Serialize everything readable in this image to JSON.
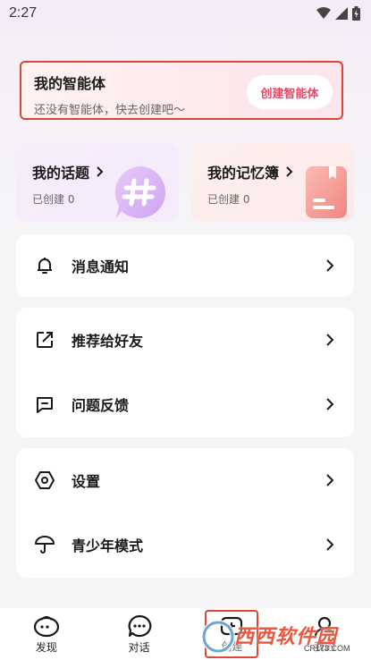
{
  "status_bar": {
    "time": "2:27"
  },
  "agent_card": {
    "title": "我的智能体",
    "subtitle": "还没有智能体，快去创建吧～",
    "create_button": "创建智能体"
  },
  "topics": {
    "title": "我的话题",
    "count": "已创建 0"
  },
  "memos": {
    "title": "我的记忆簿",
    "count": "已创建 0"
  },
  "menu": {
    "notifications": "消息通知",
    "recommend": "推荐给好友",
    "feedback": "问题反馈",
    "settings": "设置",
    "teen_mode": "青少年模式"
  },
  "tabbar": {
    "discover": "发现",
    "chat": "对话",
    "create": "创建",
    "me": "我的"
  },
  "watermark": {
    "brand": "西西软件园",
    "url": "CR173.COM"
  },
  "colors": {
    "accent": "#e8476b",
    "highlight_border": "#e0453a"
  }
}
